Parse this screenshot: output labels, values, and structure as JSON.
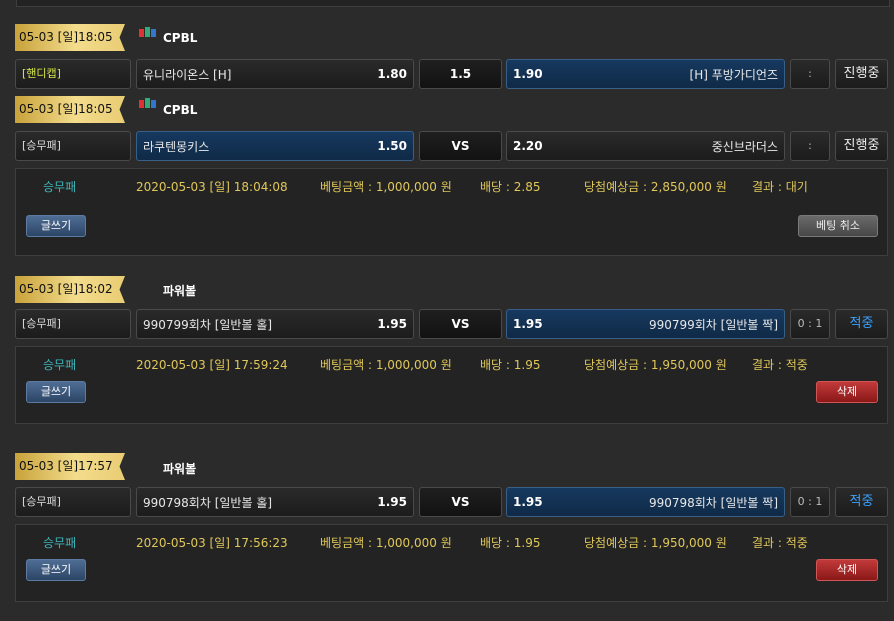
{
  "block1": {
    "date": "05-03 [일]18:05",
    "league": "CPBL",
    "rows": [
      {
        "type": "[핸디캡]",
        "home": "유니라이온스 [H]",
        "home_odd": "1.80",
        "mid": "1.5",
        "away_odd": "1.90",
        "away": "[H] 푸방가디언즈",
        "score": ":",
        "status": "진행중"
      }
    ]
  },
  "block1b": {
    "date": "05-03 [일]18:05",
    "league": "CPBL",
    "rows": [
      {
        "type": "[승무패]",
        "home": "라쿠텐몽키스",
        "home_odd": "1.50",
        "mid": "VS",
        "away_odd": "2.20",
        "away": "중신브라더스",
        "score": ":",
        "status": "진행중"
      }
    ],
    "info": {
      "type": "승무패",
      "datetime": "2020-05-03 [일] 18:04:08",
      "bet": "베팅금액 : 1,000,000 원",
      "odds": "배당 : 2.85",
      "expected": "당첨예상금 : 2,850,000 원",
      "result": "결과 : 대기",
      "write": "글쓰기",
      "cancel": "베팅 취소"
    }
  },
  "block2": {
    "date": "05-03 [일]18:02",
    "league": "파워볼",
    "row": {
      "type": "[승무패]",
      "home": "990799회차 [일반볼 홀]",
      "home_odd": "1.95",
      "mid": "VS",
      "away_odd": "1.95",
      "away": "990799회차 [일반볼 짝]",
      "score": "0 : 1",
      "status": "적중"
    },
    "info": {
      "type": "승무패",
      "datetime": "2020-05-03 [일] 17:59:24",
      "bet": "베팅금액 : 1,000,000 원",
      "odds": "배당 : 1.95",
      "expected": "당첨예상금 : 1,950,000 원",
      "result": "결과 : 적중",
      "write": "글쓰기",
      "delete": "삭제"
    }
  },
  "block3": {
    "date": "05-03 [일]17:57",
    "league": "파워볼",
    "row": {
      "type": "[승무패]",
      "home": "990798회차 [일반볼 홀]",
      "home_odd": "1.95",
      "mid": "VS",
      "away_odd": "1.95",
      "away": "990798회차 [일반볼 짝]",
      "score": "0 : 1",
      "status": "적중"
    },
    "info": {
      "type": "승무패",
      "datetime": "2020-05-03 [일] 17:56:23",
      "bet": "베팅금액 : 1,000,000 원",
      "odds": "배당 : 1.95",
      "expected": "당첨예상금 : 1,950,000 원",
      "result": "결과 : 적중",
      "write": "글쓰기",
      "delete": "삭제"
    }
  },
  "colors": {
    "accent_gold": "#e9cd74",
    "selected_blue": "#16395f",
    "hit_blue": "#3aa2ff",
    "info_gold": "#e0c75a",
    "type_teal": "#3fb4b8",
    "delete_red": "#c23a3a"
  },
  "icons": {
    "league_icon": "cpbl-logo-icon"
  }
}
